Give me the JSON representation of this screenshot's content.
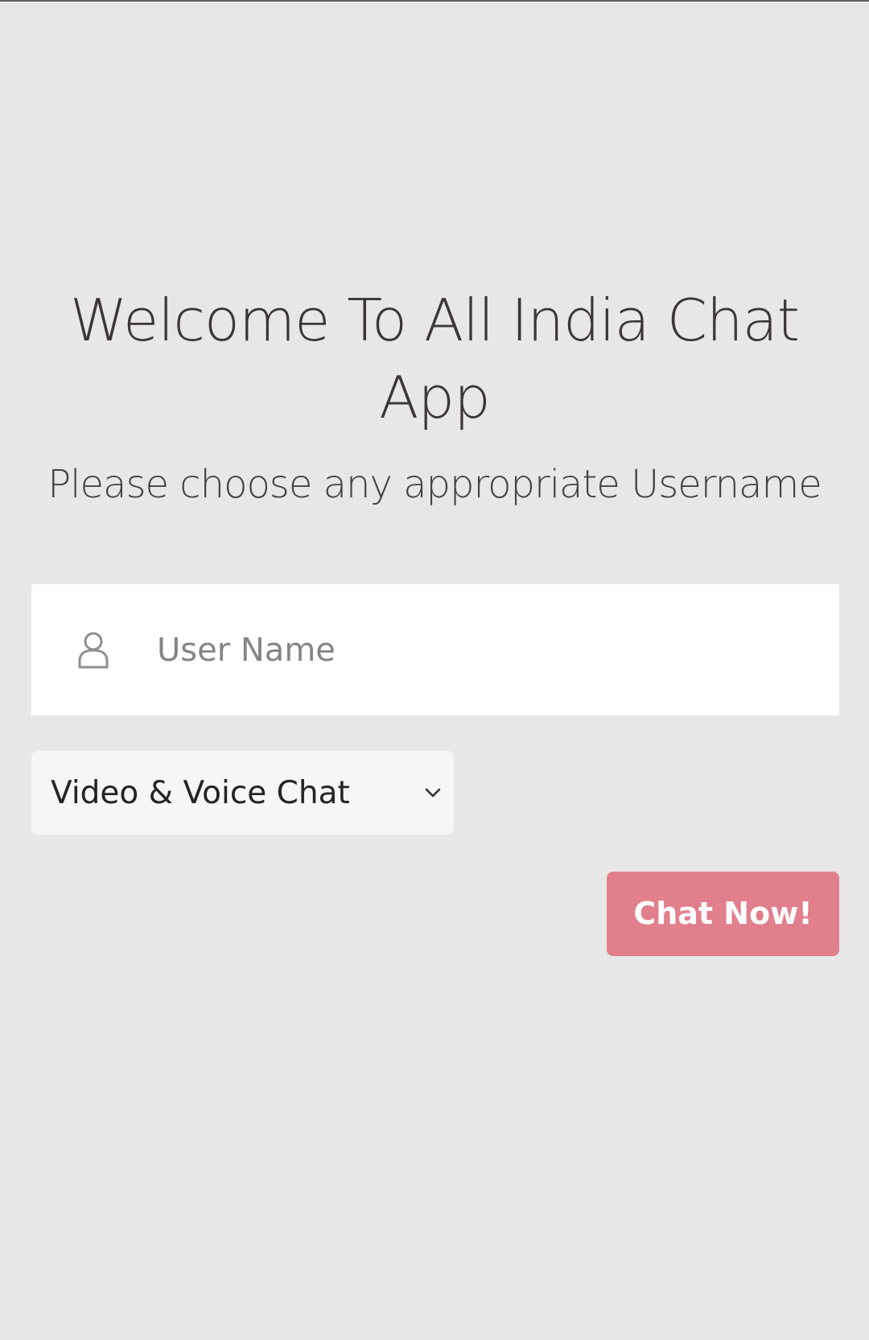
{
  "header": {
    "title": "Welcome To All India Chat App",
    "subtitle": "Please choose any appropriate Username"
  },
  "form": {
    "username": {
      "placeholder": "User Name",
      "icon": "user-icon"
    },
    "chat_mode": {
      "selected": "Video & Voice Chat",
      "icon": "chevron-down-icon"
    },
    "submit_label": "Chat Now!"
  },
  "colors": {
    "background": "#e7e7e7",
    "text": "#3c3737",
    "button": "#e27f8c"
  }
}
